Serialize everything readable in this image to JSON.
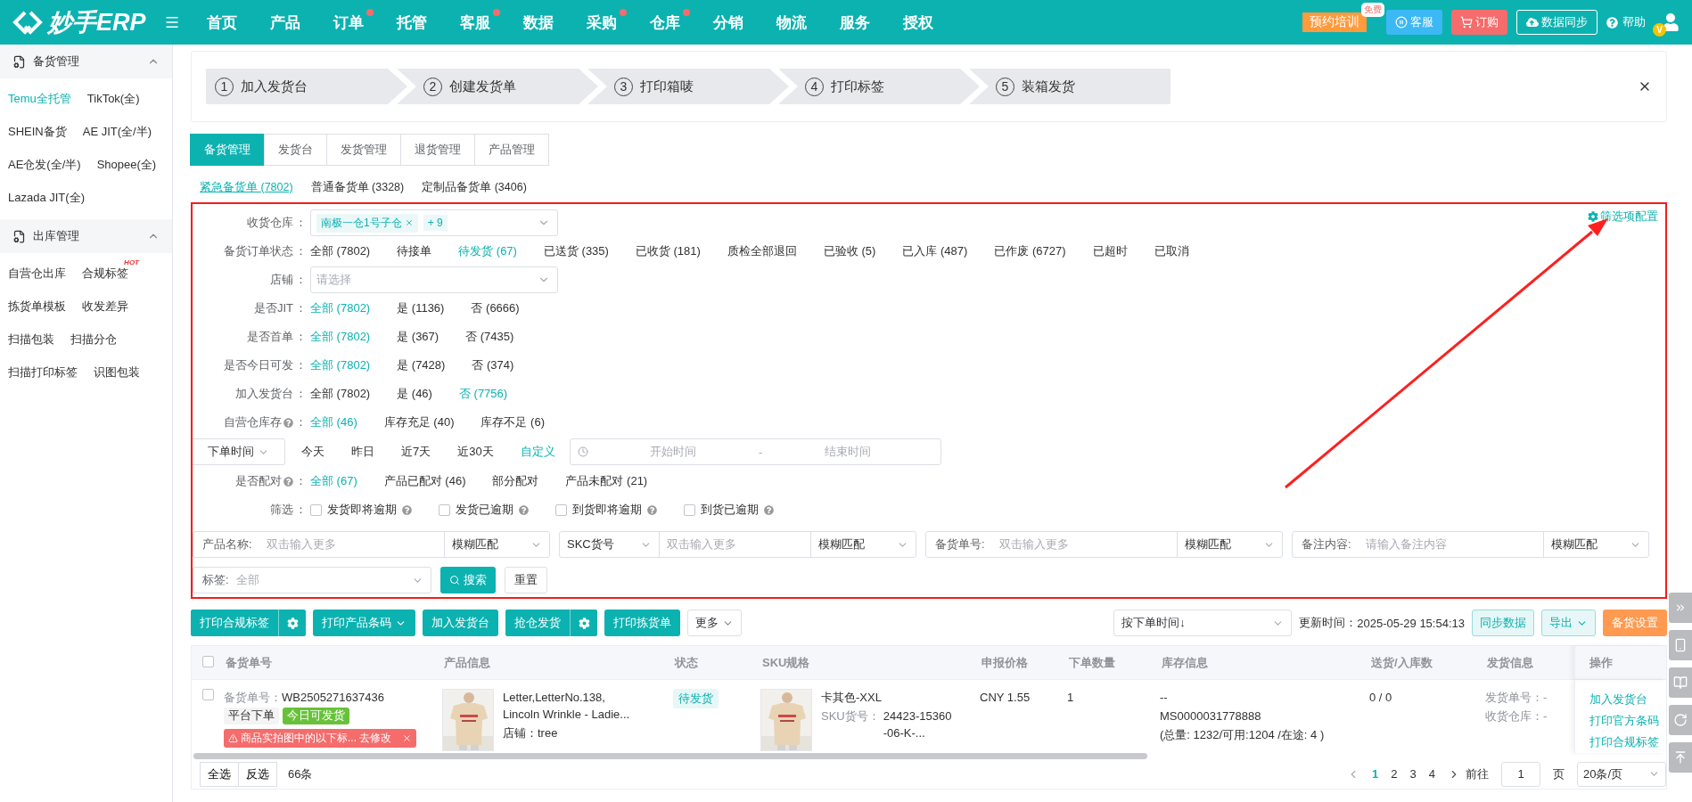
{
  "topbar": {
    "logo": "妙手ERP",
    "nav": [
      {
        "label": "首页",
        "dot": false
      },
      {
        "label": "产品",
        "dot": false
      },
      {
        "label": "订单",
        "dot": true
      },
      {
        "label": "托管",
        "dot": false
      },
      {
        "label": "客服",
        "dot": true
      },
      {
        "label": "数据",
        "dot": false
      },
      {
        "label": "采购",
        "dot": true
      },
      {
        "label": "仓库",
        "dot": true
      },
      {
        "label": "分销",
        "dot": false
      },
      {
        "label": "物流",
        "dot": false
      },
      {
        "label": "服务",
        "dot": false
      },
      {
        "label": "授权",
        "dot": false
      }
    ],
    "training": "预约培训",
    "training_badge": "免费",
    "service": "客服",
    "order": "订购",
    "sync": "数据同步",
    "help": "帮助",
    "avatar_badge": "V"
  },
  "sidebar": [
    {
      "title": "备货管理",
      "expanded": true,
      "items": [
        {
          "label": "Temu全托管",
          "selected": true
        },
        {
          "label": "TikTok(全)",
          "selected": false
        },
        {
          "label": "SHEIN备货",
          "selected": false
        },
        {
          "label": "AE JIT(全/半)",
          "selected": false
        },
        {
          "label": "AE仓发(全/半)",
          "selected": false
        },
        {
          "label": "Shopee(全)",
          "selected": false
        },
        {
          "label": "Lazada JIT(全)",
          "selected": false
        }
      ]
    },
    {
      "title": "出库管理",
      "expanded": true,
      "items": [
        {
          "label": "自营仓出库",
          "selected": false
        },
        {
          "label": "合规标签",
          "selected": false,
          "badge": "HOT"
        },
        {
          "label": "拣货单模板",
          "selected": false
        },
        {
          "label": "收发差异",
          "selected": false
        },
        {
          "label": "扫描包装",
          "selected": false
        },
        {
          "label": "扫描分仓",
          "selected": false
        },
        {
          "label": "扫描打印标签",
          "selected": false
        },
        {
          "label": "识图包装",
          "selected": false
        }
      ]
    }
  ],
  "steps": [
    {
      "number": "1",
      "label": "加入发货台"
    },
    {
      "number": "2",
      "label": "创建发货单"
    },
    {
      "number": "3",
      "label": "打印箱唛"
    },
    {
      "number": "4",
      "label": "打印标签"
    },
    {
      "number": "5",
      "label": "装箱发货"
    }
  ],
  "tabs": [
    {
      "label": "备货管理",
      "selected": true
    },
    {
      "label": "发货台",
      "selected": false
    },
    {
      "label": "发货管理",
      "selected": false
    },
    {
      "label": "退货管理",
      "selected": false
    },
    {
      "label": "产品管理",
      "selected": false
    }
  ],
  "subtabs": [
    {
      "label": "紧急备货单 (7802)",
      "selected": true
    },
    {
      "label": "普通备货单 (3328)",
      "selected": false
    },
    {
      "label": "定制品备货单 (3406)",
      "selected": false
    }
  ],
  "filters": {
    "config_link": "筛选项配置",
    "rows": [
      {
        "kind": "select_tags",
        "label": "收货仓库",
        "colon": "：",
        "tags": [
          "南极一仓1号子仓"
        ],
        "more": "+ 9"
      },
      {
        "kind": "options",
        "label": "备货订单状态",
        "colon": "：",
        "options": [
          {
            "label": "全部 (7802)",
            "selected": false
          },
          {
            "label": "待接单",
            "selected": false
          },
          {
            "label": "待发货 (67)",
            "selected": true
          },
          {
            "label": "已送货 (335)",
            "selected": false
          },
          {
            "label": "已收货 (181)",
            "selected": false
          },
          {
            "label": "质检全部退回",
            "selected": false
          },
          {
            "label": "已验收 (5)",
            "selected": false
          },
          {
            "label": "已入库 (487)",
            "selected": false
          },
          {
            "label": "已作废 (6727)",
            "selected": false
          },
          {
            "label": "已超时",
            "selected": false
          },
          {
            "label": "已取消",
            "selected": false
          }
        ]
      },
      {
        "kind": "select",
        "label": "店铺",
        "colon": "：",
        "placeholder": "请选择"
      },
      {
        "kind": "options",
        "label": "是否JIT",
        "colon": "：",
        "options": [
          {
            "label": "全部 (7802)",
            "selected": true
          },
          {
            "label": "是 (1136)",
            "selected": false
          },
          {
            "label": "否 (6666)",
            "selected": false
          }
        ]
      },
      {
        "kind": "options",
        "label": "是否首单",
        "colon": "：",
        "options": [
          {
            "label": "全部 (7802)",
            "selected": true
          },
          {
            "label": "是 (367)",
            "selected": false
          },
          {
            "label": "否 (7435)",
            "selected": false
          }
        ]
      },
      {
        "kind": "options",
        "label": "是否今日可发",
        "colon": "：",
        "options": [
          {
            "label": "全部 (7802)",
            "selected": true
          },
          {
            "label": "是 (7428)",
            "selected": false
          },
          {
            "label": "否 (374)",
            "selected": false
          }
        ]
      },
      {
        "kind": "options",
        "label": "加入发货台",
        "colon": "：",
        "options": [
          {
            "label": "全部 (7802)",
            "selected": false
          },
          {
            "label": "是 (46)",
            "selected": false
          },
          {
            "label": "否 (7756)",
            "selected": true
          }
        ]
      },
      {
        "kind": "options",
        "label": "自营仓库存",
        "help": true,
        "colon": "：",
        "options": [
          {
            "label": "全部 (46)",
            "selected": true
          },
          {
            "label": "库存充足 (40)",
            "selected": false
          },
          {
            "label": "库存不足 (6)",
            "selected": false
          }
        ]
      },
      {
        "kind": "time",
        "dropdown": "下单时间",
        "options": [
          {
            "label": "今天",
            "selected": false
          },
          {
            "label": "昨日",
            "selected": false
          },
          {
            "label": "近7天",
            "selected": false
          },
          {
            "label": "近30天",
            "selected": false
          },
          {
            "label": "自定义",
            "selected": true
          }
        ],
        "start": "开始时间",
        "separator": "-",
        "end": "结束时间"
      },
      {
        "kind": "options",
        "label": "是否配对",
        "help": true,
        "colon": "：",
        "options": [
          {
            "label": "全部 (67)",
            "selected": true
          },
          {
            "label": "产品已配对 (46)",
            "selected": false
          },
          {
            "label": "部分配对",
            "selected": false
          },
          {
            "label": "产品未配对 (21)",
            "selected": false
          }
        ]
      },
      {
        "kind": "checks",
        "label": "筛选",
        "colon": "：",
        "checks": [
          {
            "label": "发货即将逾期",
            "checked": false
          },
          {
            "label": "发货已逾期",
            "checked": false
          },
          {
            "label": "到货即将逾期",
            "checked": false
          },
          {
            "label": "到货已逾期",
            "checked": false
          }
        ]
      }
    ],
    "search_fields": [
      {
        "kind": "text",
        "label": "产品名称:",
        "placeholder": "双击输入更多",
        "match": "模糊匹配"
      },
      {
        "kind": "select",
        "label": "SKC货号",
        "placeholder": "双击输入更多",
        "match": "模糊匹配"
      },
      {
        "kind": "text",
        "label": "备货单号:",
        "placeholder": "双击输入更多",
        "match": "模糊匹配"
      },
      {
        "kind": "text",
        "label": "备注内容:",
        "placeholder": "请输入备注内容",
        "match": "模糊匹配"
      }
    ],
    "tag_field": {
      "label": "标签:",
      "placeholder": "全部"
    },
    "search_button": "搜索",
    "reset_button": "重置"
  },
  "toolbar": {
    "buttons": [
      {
        "label": "打印合规标签",
        "kind": "split"
      },
      {
        "label": "打印产品条码",
        "kind": "dropdown"
      },
      {
        "label": "加入发货台",
        "kind": "plain"
      },
      {
        "label": "抢仓发货",
        "kind": "split"
      },
      {
        "label": "打印拣货单",
        "kind": "plain"
      },
      {
        "label": "更多",
        "kind": "outline"
      }
    ],
    "sort": "按下单时间↓",
    "update_label": "更新时间：",
    "update_time": "2025-05-29 15:54:13",
    "sync": "同步数据",
    "export": "导出",
    "settings": "备货设置"
  },
  "table": {
    "header_checked": false,
    "columns": [
      "备货单号",
      "产品信息",
      "状态",
      "SKU规格",
      "申报价格",
      "下单数量",
      "库存信息",
      "送货/入库数",
      "发货信息",
      "操作"
    ],
    "rows": [
      {
        "checked": false,
        "order_label": "备货单号：",
        "order_no": "WB2505271637436",
        "tags": [
          {
            "label": "平台下单",
            "kind": "plain"
          },
          {
            "label": "今日可发货",
            "kind": "green"
          }
        ],
        "alert": "商品实拍图中的以下标... 去修改",
        "product_name": "Letter,LetterNo.138, Lincoln Wrinkle - Ladie...",
        "shop_label": "店铺：",
        "shop": "tree",
        "status": "待发货",
        "sku_name": "卡其色-XXL",
        "sku_code_label": "SKU货号：",
        "sku_code": "24423-15360-06-K-...",
        "price": "CNY 1.55",
        "quantity": "1",
        "stock": [
          "--",
          "MS0000031778888",
          "(总量: 1232/可用:1204 /在途: 4 )"
        ],
        "delivered": "0 / 0",
        "ship_info": [
          "发货单号：-",
          "收货仓库：-"
        ],
        "actions": [
          "加入发货台",
          "打印官方条码",
          "打印合规标签"
        ]
      }
    ]
  },
  "footer": {
    "select_all": "全选",
    "invert": "反选",
    "count": "66条",
    "pages": [
      {
        "label": "1",
        "selected": true
      },
      {
        "label": "2",
        "selected": false
      },
      {
        "label": "3",
        "selected": false
      },
      {
        "label": "4",
        "selected": false
      }
    ],
    "goto": "前往",
    "page_input": "1",
    "page_unit": "页",
    "page_size": "20条/页"
  }
}
